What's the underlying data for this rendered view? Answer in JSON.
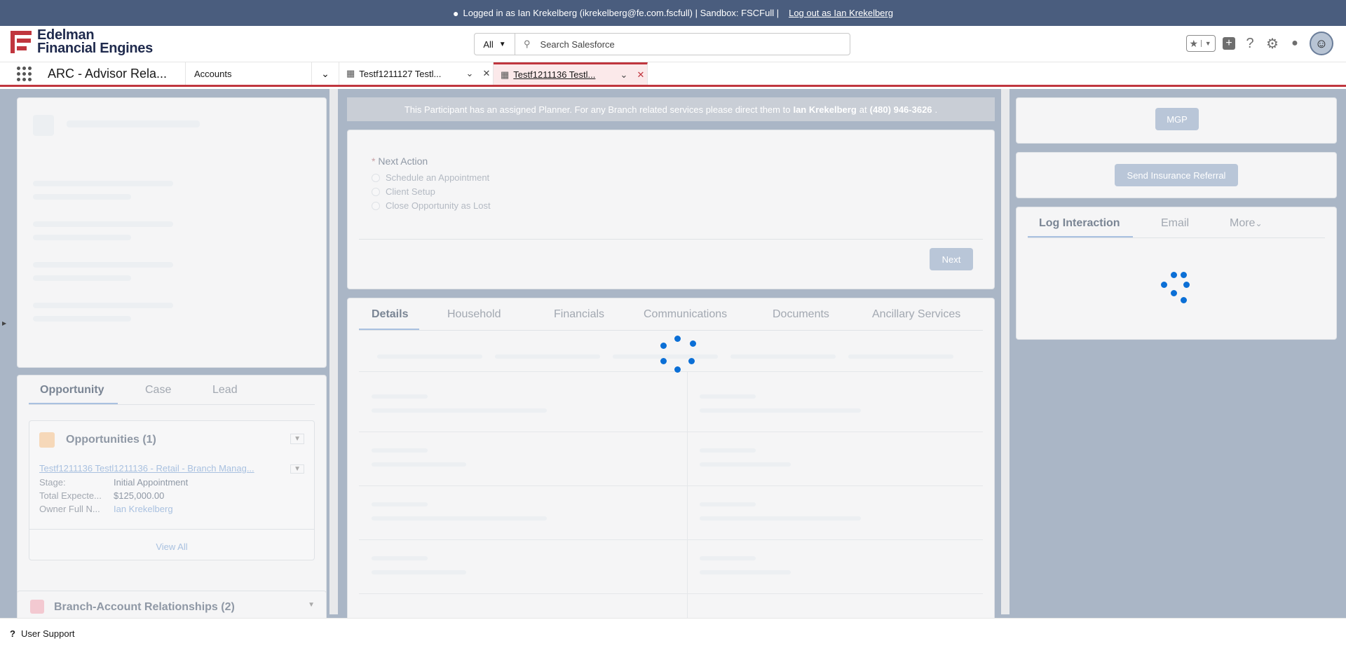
{
  "banner": {
    "logged_in_text": "Logged in as Ian Krekelberg (ikrekelberg@fe.com.fscfull) | Sandbox: FSCFull |",
    "logout_link": "Log out as Ian Krekelberg"
  },
  "header": {
    "logo_line1": "Edelman",
    "logo_line2": "Financial Engines",
    "search_scope": "All",
    "search_placeholder": "Search Salesforce"
  },
  "nav": {
    "app_name": "ARC - Advisor Rela...",
    "object_select": "Accounts",
    "tabs": [
      {
        "label": "Testf1211127 Testl..."
      },
      {
        "label": "Testf1211136 Testl..."
      }
    ]
  },
  "notice": {
    "prefix": "This Participant has an assigned Planner. For any Branch related services please direct them to",
    "planner": "Ian Krekelberg",
    "at": "at",
    "phone": "(480) 946-3626",
    "suffix": "."
  },
  "flow": {
    "question": "Next Action",
    "options": [
      "Schedule an Appointment",
      "Client Setup",
      "Close Opportunity as Lost"
    ],
    "next_button": "Next"
  },
  "detail_tabs": [
    "Details",
    "Household",
    "Financials",
    "Communications",
    "Documents",
    "Ancillary Services"
  ],
  "left_tabs": [
    "Opportunity",
    "Case",
    "Lead"
  ],
  "opportunities": {
    "title": "Opportunities (1)",
    "record_name": "Testf1211136 Testl1211136 - Retail - Branch Manag...",
    "fields": [
      {
        "label": "Stage:",
        "value": "Initial Appointment"
      },
      {
        "label": "Total Expecte...",
        "value": "$125,000.00"
      },
      {
        "label": "Owner Full N...",
        "value": "Ian Krekelberg"
      }
    ],
    "view_all": "View All"
  },
  "branch_rel": {
    "title": "Branch-Account Relationships (2)"
  },
  "right": {
    "mgp_button": "MGP",
    "insurance_button": "Send Insurance Referral",
    "activity_tabs": [
      "Log Interaction",
      "Email",
      "More"
    ]
  },
  "footer": {
    "help_icon": "question-icon",
    "label": "User Support"
  },
  "colors": {
    "accent": "#0b6fd6",
    "active_tab_border": "#c0363e",
    "banner_bg": "#4a5d7e"
  }
}
